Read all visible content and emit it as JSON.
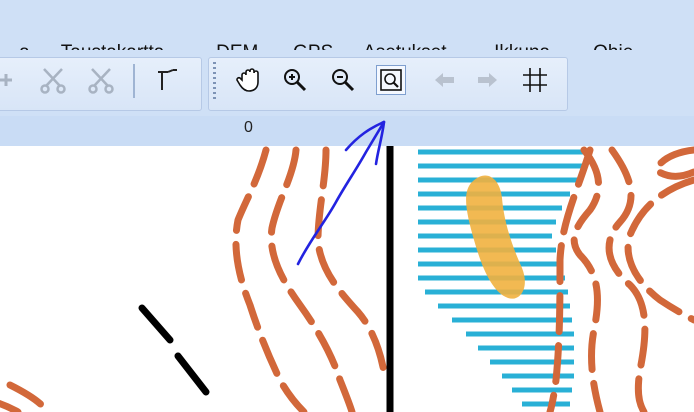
{
  "menu": {
    "items": [
      {
        "pre": "",
        "u": "",
        "post": "a"
      },
      {
        "pre": "Ta",
        "u": "u",
        "post": "stakartta"
      },
      {
        "pre": "D",
        "u": "E",
        "post": "M"
      },
      {
        "pre": "",
        "u": "G",
        "post": "PS"
      },
      {
        "pre": "Asetukset",
        "u": "",
        "post": ""
      },
      {
        "pre": "",
        "u": "I",
        "post": "kkuna"
      },
      {
        "pre": "O",
        "u": "h",
        "post": "je"
      }
    ]
  },
  "toolbar": {
    "icons": [
      "plus-icon",
      "scissors-icon",
      "scissors-icon",
      "line-tool-icon",
      "hand-pan-icon",
      "zoom-in-icon",
      "zoom-out-icon",
      "zoom-window-icon",
      "arrow-left-icon",
      "arrow-right-icon",
      "grid-icon"
    ]
  },
  "ruler": {
    "value": "0"
  },
  "colors": {
    "menubar": "#cfe0f6",
    "contour": "#d2683a",
    "water": "#29b0d6",
    "sand": "#f1b13f",
    "annotation": "#2323e0"
  }
}
